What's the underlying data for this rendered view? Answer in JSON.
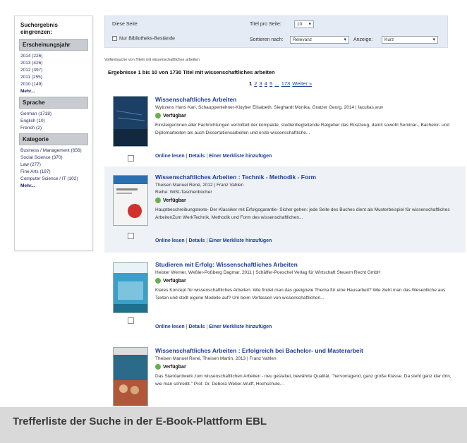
{
  "sidebar": {
    "title": "Suchergebnis\neingrenzen:",
    "sections": [
      {
        "heading": "Erscheinungsjahr",
        "items": [
          "2014 (226)",
          "2013 (426)",
          "2012 (397)",
          "2011 (255)",
          "2010 (149)"
        ],
        "more": "Mehr..."
      },
      {
        "heading": "Sprache",
        "items": [
          "German (1718)",
          "English (10)",
          "French (2)"
        ]
      },
      {
        "heading": "Kategorie",
        "items": [
          "Business / Management (656)",
          "Social Science (370)",
          "Law (277)",
          "Fine Arts (187)",
          "Computer Science / IT (102)"
        ],
        "more": "Mehr..."
      }
    ]
  },
  "filterbar": {
    "page_label": "Diese Seite",
    "checkbox_label": "Nur Bibliotheks-Bestände",
    "per_page_label": "Titel pro Seite:",
    "per_page_value": "10",
    "sort_label": "Sortieren nach:",
    "sort_value": "Relevanz",
    "display_label": "Anzeige:",
    "display_value": "Kurz"
  },
  "searchinfo": "Volltextsuche von Titeln mit wissenschaftliches arbeiten",
  "resultcount": "Ergebnisse 1 bis 10 von 1730 Titel mit wissenschaftliches arbeiten",
  "pager": {
    "pages": [
      "1",
      "2",
      "3",
      "4",
      "5"
    ],
    "ellipsis": "...",
    "last": "173",
    "next": "Weiter »"
  },
  "results": [
    {
      "title": "Wissenschaftliches Arbeiten",
      "authors": "Wytrzens Hans Karl, Schauppenlehner-Kloyber Elisabeth, Sieghardt Monika, Gratzer Georg, 2014 | facultas.wuv",
      "series": "",
      "availability": "Verfügbar",
      "description": "Einsteigerinnen aller Fachrichtungen vermittelt der kompakte, studienbegleitende Ratgeber das Rüstzeug, damit sowohl Seminar-, Bachelor- und Diplomarbeiten als auch Dissertationsarbeiten und erste wissenschaftliche...",
      "links": [
        "Online lesen",
        "Details",
        "Einer Merkliste hinzufügen"
      ],
      "cover_color": "#1c3f66"
    },
    {
      "title": "Wissenschaftliches Arbeiten : Technik - Methodik - Form",
      "authors": "Theisen Manuel René, 2012 | Franz Vahlen",
      "series": "Reihe:   WiSt-Taschenbücher",
      "availability": "Verfügbar",
      "description": "Hauptbeschreibungstexte- Der Klassiker mit Erfolgsgarantie- Sicher gehen: jede Seite des Buches dient als Musterbeispiel für wissenschaftliches ArbeitenZum WerkTechnik, Methodik und Form des wissenschaftlichen...",
      "links": [
        "Online lesen",
        "Details",
        "Einer Merkliste hinzufügen"
      ],
      "cover_color": "#f2f2f2"
    },
    {
      "title": "Studieren mit Erfolg: Wissenschaftliches Arbeiten",
      "authors": "Heister Werner, Weßler-Poßberg Dagmar, 2011 | Schäffer-Poeschel Verlag für Wirtschaft Steuern Recht GmbH",
      "series": "",
      "availability": "Verfügbar",
      "description": "Klares Konzept für wissenschaftliches Arbeiten. Wie findet man das geeignete Thema für eine Hausarbeit? Wie zieht man das Wesentliche aus Texten und stellt eigene Modelle auf? Um beim Verfassen von wissenschaftlichen...",
      "links": [
        "Online lesen",
        "Details",
        "Einer Merkliste hinzufügen"
      ],
      "cover_color": "#3aa0c8"
    },
    {
      "title": "Wissenschaftliches Arbeiten : Erfolgreich bei Bachelor- und Masterarbeit",
      "authors": "Theisen Manuel René, Theisen Martin, 2013 | Franz Vahlen",
      "series": "",
      "availability": "Verfügbar",
      "description": "Das Standardwerk zum wissenschaftlichen Arbeiten - neu gestaltet, bewährte Qualität. \"hervorragend, ganz große Klasse. Da steht ganz klar drin, wie man schreibt.\" Prof. Dr. Debora Weber-Wulff, Hochschule...",
      "links": [],
      "cover_color": "#2c6a8a"
    }
  ],
  "caption": "Trefferliste der Suche in der E-Book-Plattform EBL"
}
